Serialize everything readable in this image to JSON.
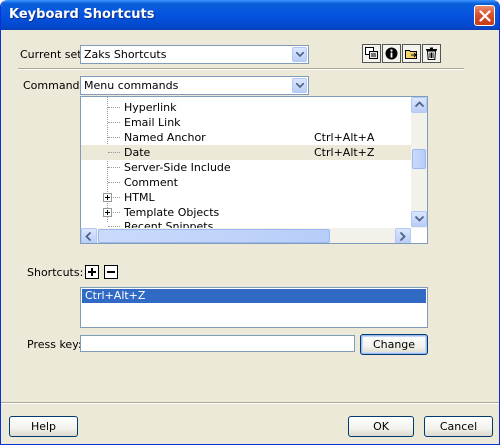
{
  "window": {
    "title": "Keyboard Shortcuts"
  },
  "current_set": {
    "label": "Current set:",
    "value": "Zaks Shortcuts"
  },
  "toolbar": {
    "icons": [
      "duplicate-set-icon",
      "info-icon",
      "export-set-icon",
      "delete-set-icon"
    ]
  },
  "commands": {
    "label": "Commands:",
    "value": "Menu commands"
  },
  "tree": {
    "rows": [
      {
        "name": "Hyperlink",
        "shortcut": "",
        "expandable": false,
        "selected": false
      },
      {
        "name": "Email Link",
        "shortcut": "",
        "expandable": false,
        "selected": false
      },
      {
        "name": "Named Anchor",
        "shortcut": "Ctrl+Alt+A",
        "expandable": false,
        "selected": false
      },
      {
        "name": "Date",
        "shortcut": "Ctrl+Alt+Z",
        "expandable": false,
        "selected": true
      },
      {
        "name": "Server-Side Include",
        "shortcut": "",
        "expandable": false,
        "selected": false
      },
      {
        "name": "Comment",
        "shortcut": "",
        "expandable": false,
        "selected": false
      },
      {
        "name": "HTML",
        "shortcut": "",
        "expandable": true,
        "selected": false
      },
      {
        "name": "Template Objects",
        "shortcut": "",
        "expandable": true,
        "selected": false
      },
      {
        "name": "Recent Snippets",
        "shortcut": "",
        "expandable": false,
        "selected": false
      }
    ]
  },
  "shortcuts": {
    "label": "Shortcuts:",
    "items": [
      "Ctrl+Alt+Z"
    ]
  },
  "press_key": {
    "label": "Press key:",
    "value": "",
    "change_label": "Change"
  },
  "footer": {
    "help_label": "Help",
    "ok_label": "OK",
    "cancel_label": "Cancel"
  }
}
